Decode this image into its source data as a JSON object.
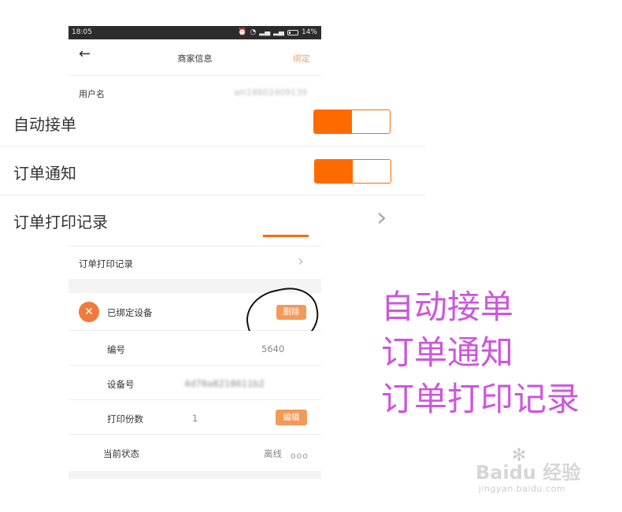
{
  "status_bar": {
    "time": "18:05",
    "battery": "14%"
  },
  "nav": {
    "back_icon": "arrow-left-icon",
    "title": "商家信息",
    "bind_label": "绑定"
  },
  "user": {
    "label": "用户名",
    "value": "wh18602409139"
  },
  "zoomed": {
    "auto_accept_label": "自动接单",
    "auto_accept_on": true,
    "order_notify_label": "订单通知",
    "order_notify_on": true,
    "print_log_label": "订单打印记录"
  },
  "print_log_row": {
    "label": "订单打印记录"
  },
  "device": {
    "section_label": "已绑定设备",
    "delete_label": "删除",
    "id_label": "编号",
    "id_value": "5640",
    "device_no_label": "设备号",
    "device_no_value": "4d78a8218611b2",
    "copies_label": "打印份数",
    "copies_value": "1",
    "edit_label": "编辑",
    "state_label": "当前状态",
    "state_value": "离线",
    "more_label": "ooo"
  },
  "annotation": {
    "lines": [
      "自动接单",
      "订单通知",
      "订单打印记录"
    ]
  },
  "watermark": {
    "brand": "Bai",
    "brand_mid": "du",
    "brand_cn": "经验",
    "site": "jingyan.baidu.com"
  },
  "colors": {
    "accent": "#ff6a00",
    "annotation": "#cd56dc",
    "button": "#f39a59"
  }
}
